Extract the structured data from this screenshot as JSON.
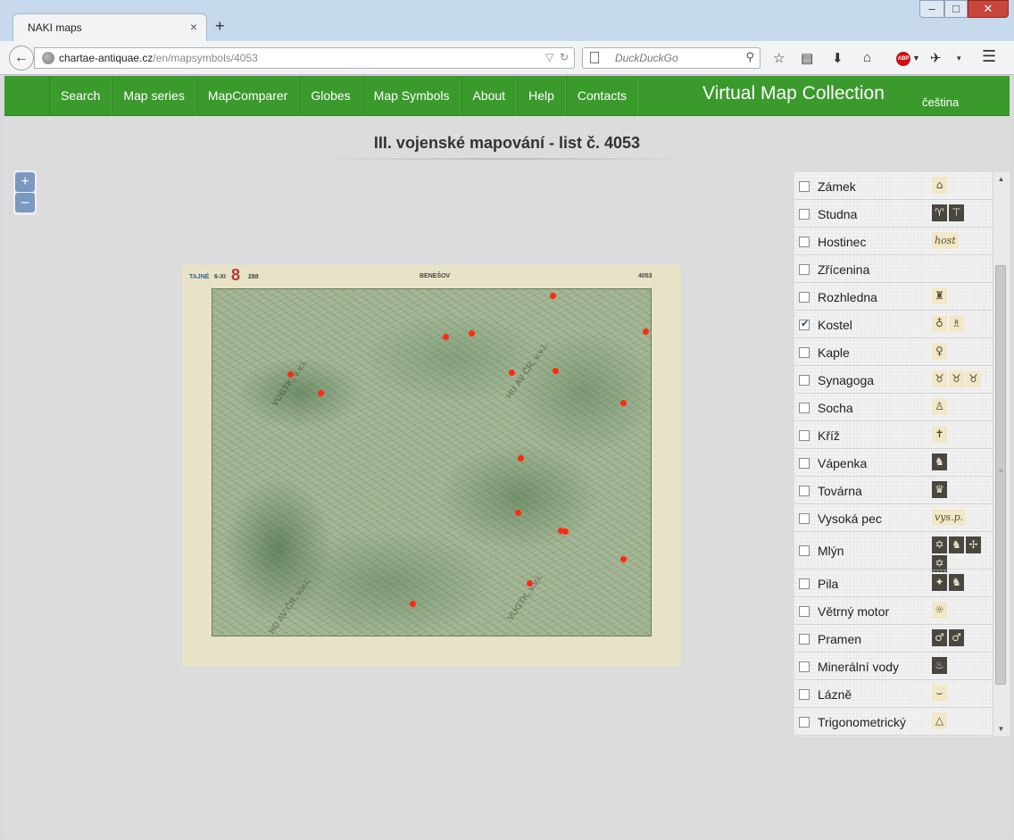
{
  "browser": {
    "tab_title": "NAKI maps",
    "tab_close": "×",
    "new_tab": "+",
    "url_host": "chartae-antiquae.cz",
    "url_path": "/en/mapsymbols/4053",
    "search_placeholder": "DuckDuckGo",
    "window_controls": {
      "minimize": "–",
      "maximize": "□",
      "close": "✕"
    }
  },
  "header": {
    "menu": [
      "Search",
      "Map series",
      "MapComparer",
      "Globes",
      "Map Symbols",
      "About",
      "Help",
      "Contacts"
    ],
    "brand": "Virtual Map Collection",
    "language": "čeština"
  },
  "page": {
    "title": "III. vojenské mapování - list č. 4053",
    "zoom_in": "+",
    "zoom_out": "–"
  },
  "map": {
    "header_left": "TAJNÉ",
    "header_center": "BENEŠOV",
    "header_right": "4053",
    "header_code": "6-XI",
    "header_number": "8",
    "header_seq": "288",
    "stamps": [
      "VUGTK, v.v.i.",
      "HU AV ČR, v.v.i.",
      "HU AV ČR, v.v.i.",
      "VUGTK, v.v.i."
    ],
    "poi_color": "#ff2a10",
    "points": [
      {
        "x": 0.774,
        "y": 0.019
      },
      {
        "x": 0.985,
        "y": 0.122
      },
      {
        "x": 0.531,
        "y": 0.138
      },
      {
        "x": 0.59,
        "y": 0.128
      },
      {
        "x": 0.178,
        "y": 0.246
      },
      {
        "x": 0.246,
        "y": 0.299
      },
      {
        "x": 0.681,
        "y": 0.239
      },
      {
        "x": 0.78,
        "y": 0.235
      },
      {
        "x": 0.934,
        "y": 0.326
      },
      {
        "x": 0.7,
        "y": 0.485
      },
      {
        "x": 0.694,
        "y": 0.642
      },
      {
        "x": 0.793,
        "y": 0.694
      },
      {
        "x": 0.803,
        "y": 0.697
      },
      {
        "x": 0.934,
        "y": 0.776
      },
      {
        "x": 0.722,
        "y": 0.846
      },
      {
        "x": 0.456,
        "y": 0.905
      }
    ]
  },
  "legend": {
    "items": [
      {
        "label": "Zámek",
        "checked": false,
        "symbols": [
          {
            "glyph": "⌂"
          }
        ]
      },
      {
        "label": "Studna",
        "checked": false,
        "symbols": [
          {
            "glyph": "♈",
            "dark": true
          },
          {
            "glyph": "⊤",
            "dark": true
          }
        ]
      },
      {
        "label": "Hostinec",
        "checked": false,
        "symbols": [
          {
            "glyph": "host",
            "wide": true
          }
        ]
      },
      {
        "label": "Zřícenina",
        "checked": false,
        "symbols": []
      },
      {
        "label": "Rozhledna",
        "checked": false,
        "symbols": [
          {
            "glyph": "♜"
          }
        ]
      },
      {
        "label": "Kostel",
        "checked": true,
        "symbols": [
          {
            "glyph": "♁"
          },
          {
            "glyph": "♗"
          }
        ]
      },
      {
        "label": "Kaple",
        "checked": false,
        "symbols": [
          {
            "glyph": "♀"
          }
        ]
      },
      {
        "label": "Synagoga",
        "checked": false,
        "symbols": [
          {
            "glyph": "♉"
          },
          {
            "glyph": "♉"
          },
          {
            "glyph": "♉"
          }
        ]
      },
      {
        "label": "Socha",
        "checked": false,
        "symbols": [
          {
            "glyph": "♙"
          }
        ]
      },
      {
        "label": "Kříž",
        "checked": false,
        "symbols": [
          {
            "glyph": "✝"
          }
        ]
      },
      {
        "label": "Vápenka",
        "checked": false,
        "symbols": [
          {
            "glyph": "♞",
            "dark": true
          }
        ]
      },
      {
        "label": "Továrna",
        "checked": false,
        "symbols": [
          {
            "glyph": "♛",
            "dark": true
          }
        ]
      },
      {
        "label": "Vysoká pec",
        "checked": false,
        "symbols": [
          {
            "glyph": "vys.p.",
            "wide": true
          }
        ]
      },
      {
        "label": "Mlýn",
        "checked": false,
        "tall": true,
        "symbols": [
          {
            "glyph": "✡",
            "dark": true
          },
          {
            "glyph": "♞",
            "dark": true
          },
          {
            "glyph": "✢",
            "dark": true
          },
          {
            "glyph": "✡",
            "dark": true
          }
        ]
      },
      {
        "label": "Pila",
        "checked": false,
        "symbols": [
          {
            "glyph": "✦",
            "dark": true
          },
          {
            "glyph": "♞",
            "dark": true
          }
        ]
      },
      {
        "label": "Větrný motor",
        "checked": false,
        "symbols": [
          {
            "glyph": "☼"
          }
        ]
      },
      {
        "label": "Pramen",
        "checked": false,
        "symbols": [
          {
            "glyph": "♂",
            "dark": true
          },
          {
            "glyph": "♂",
            "dark": true
          }
        ]
      },
      {
        "label": "Minerální vody",
        "checked": false,
        "symbols": [
          {
            "glyph": "♨",
            "dark": true
          }
        ]
      },
      {
        "label": "Lázně",
        "checked": false,
        "symbols": [
          {
            "glyph": "⌣"
          }
        ]
      },
      {
        "label": "Trigonometrický",
        "checked": false,
        "symbols": [
          {
            "glyph": "△"
          }
        ]
      }
    ]
  }
}
